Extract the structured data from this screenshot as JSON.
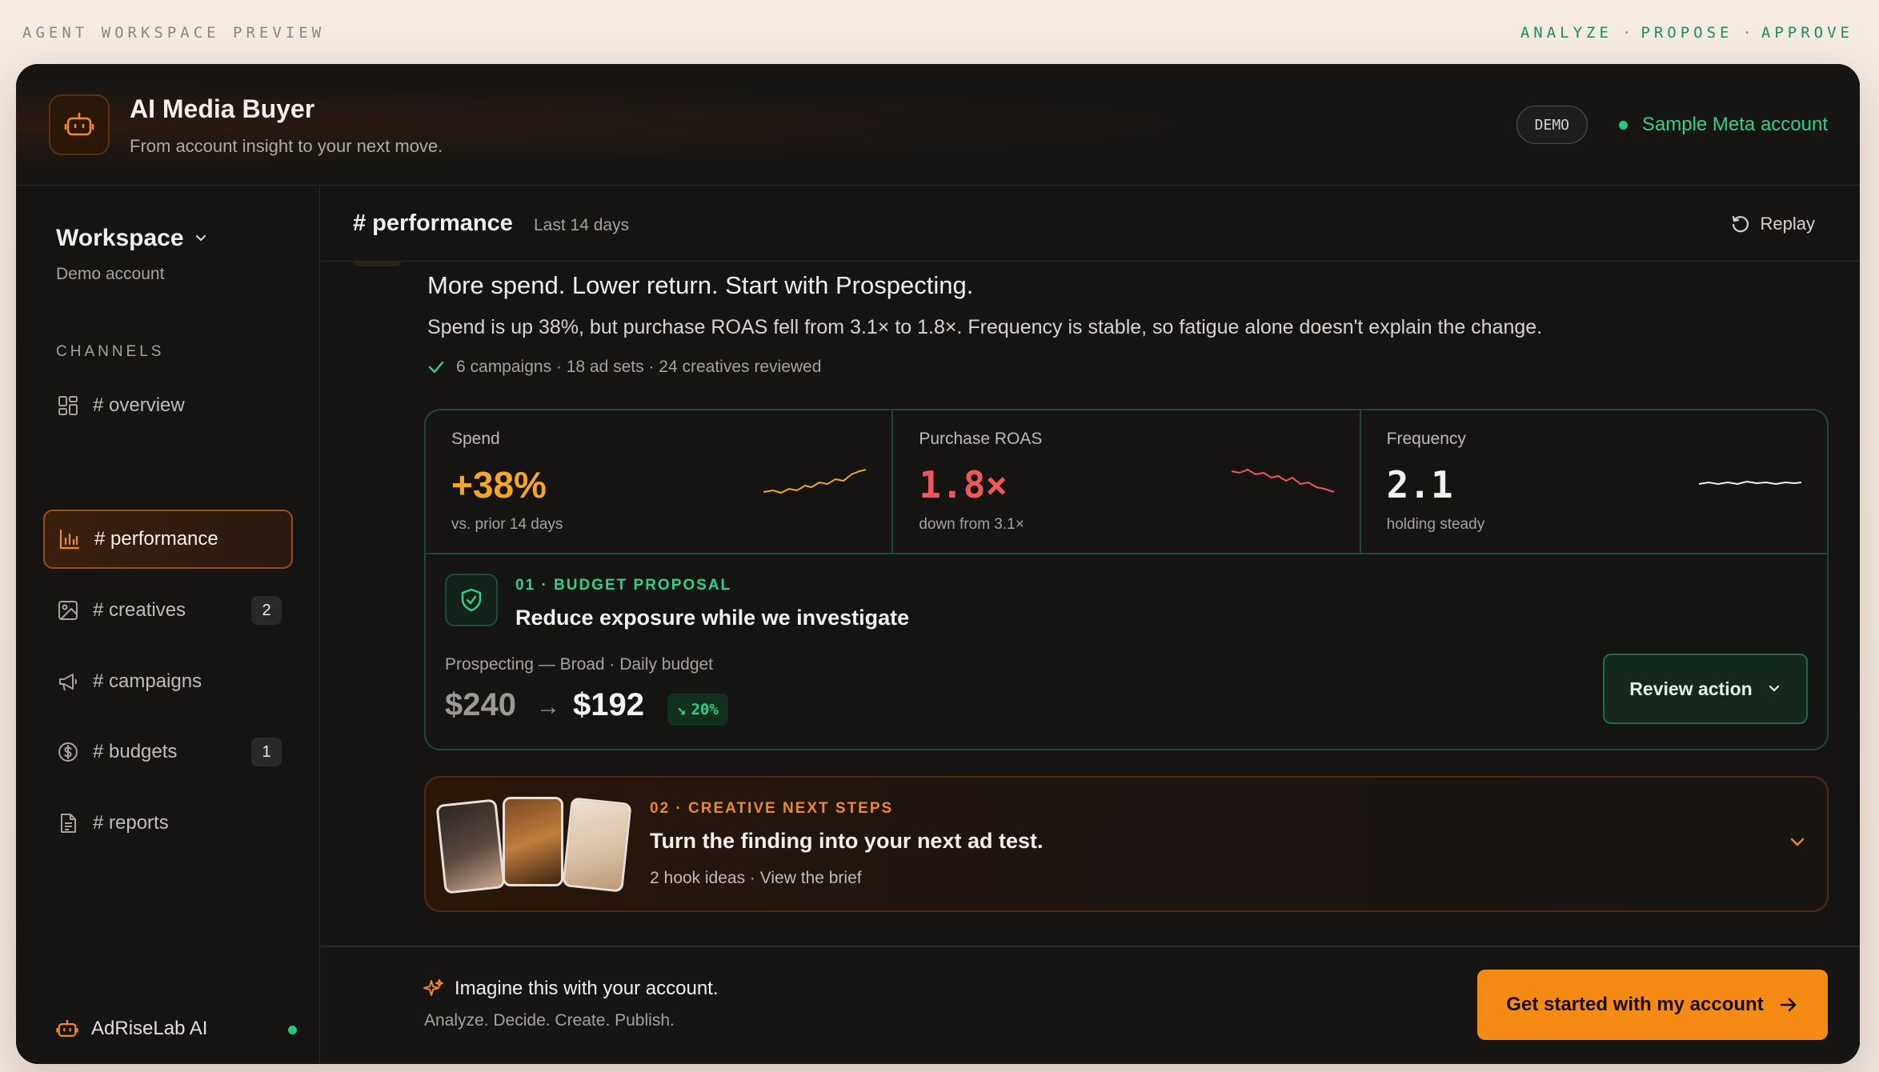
{
  "preview": {
    "label": "AGENT WORKSPACE PREVIEW",
    "steps": [
      "ANALYZE",
      "PROPOSE",
      "APPROVE"
    ]
  },
  "header": {
    "title": "AI Media Buyer",
    "subtitle": "From account insight to your next move.",
    "demo_badge": "DEMO",
    "account": "Sample Meta account"
  },
  "sidebar": {
    "workspace_title": "Workspace",
    "workspace_sub": "Demo account",
    "channels_label": "CHANNELS",
    "items": [
      {
        "label": "# overview",
        "icon": "grid-icon",
        "badge": ""
      },
      {
        "label": "# performance",
        "icon": "bar-chart-icon",
        "badge": "",
        "active": true
      },
      {
        "label": "# creatives",
        "icon": "image-icon",
        "badge": "2"
      },
      {
        "label": "# campaigns",
        "icon": "megaphone-icon",
        "badge": ""
      },
      {
        "label": "# budgets",
        "icon": "dollar-icon",
        "badge": "1"
      },
      {
        "label": "# reports",
        "icon": "document-icon",
        "badge": ""
      }
    ],
    "footer": "AdRiseLab AI"
  },
  "channel": {
    "title": "# performance",
    "range": "Last 14 days",
    "replay": "Replay"
  },
  "insight": {
    "headline": "More spend. Lower return. Start with Prospecting.",
    "summary": "Spend is up 38%, but purchase ROAS fell from 3.1× to 1.8×. Frequency is stable, so fatigue alone doesn't explain the change.",
    "reviewed": "6 campaigns · 18 ad sets · 24 creatives reviewed"
  },
  "metrics": [
    {
      "label": "Spend",
      "value": "+38%",
      "sub": "vs. prior 14 days",
      "color": "#f5a623"
    },
    {
      "label": "Purchase ROAS",
      "value": "1.8×",
      "sub": "down from 3.1×",
      "color": "#f0575a"
    },
    {
      "label": "Frequency",
      "value": "2.1",
      "sub": "holding steady",
      "color": "#f2efec"
    }
  ],
  "proposal": {
    "tag": "01 · BUDGET PROPOSAL",
    "title": "Reduce exposure while we investigate",
    "line": "Prospecting — Broad · Daily budget",
    "old": "$240",
    "new": "$192",
    "change": "20%",
    "button": "Review action"
  },
  "creative": {
    "tag": "02 · CREATIVE NEXT STEPS",
    "title": "Turn the finding into your next ad test.",
    "sub": "2 hook ideas · View the brief"
  },
  "cta": {
    "title": "Imagine this with your account.",
    "sub": "Analyze. Decide. Create. Publish.",
    "button": "Get started with my account"
  },
  "colors": {
    "accent": "#f58a14",
    "green": "#2ed28a",
    "red": "#f0575a",
    "amber": "#f5a623"
  }
}
